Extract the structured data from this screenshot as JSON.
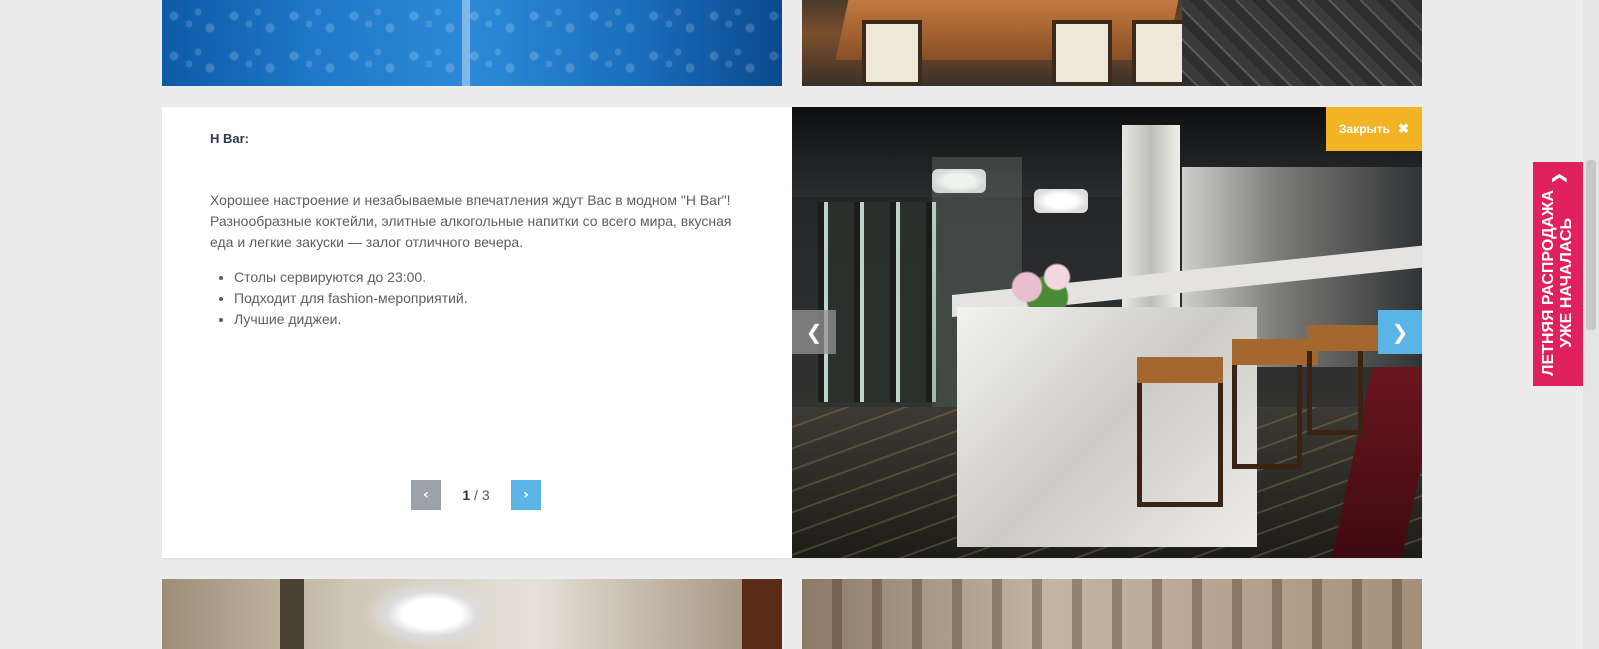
{
  "card": {
    "title": "H Bar:",
    "description": "Хорошее настроение и незабываемые впечатления ждут Вас в модном \"H Bar\"! Разнообразные коктейли, элитные алкогольные напитки со всего мира, вкусная еда и легкие закуски — залог отличного вечера.",
    "bullets": [
      "Столы сервируются до 23:00.",
      "Подходит для fashion-мероприятий.",
      "Лучшие диджеи."
    ],
    "pager": {
      "current": "1",
      "separator": "/ 3",
      "prev_icon": "chevron-left-icon",
      "next_icon": "chevron-right-icon"
    }
  },
  "slider": {
    "close_label": "Закрыть",
    "close_icon": "✖",
    "prev_icon": "chevron-left-icon",
    "next_icon": "chevron-right-icon",
    "image_alt": "H Bar interior with marble counter and bar stools"
  },
  "promo": {
    "line1": "ЛЕТНЯЯ РАСПРОДАЖА",
    "line2": "УЖЕ НАЧАЛАСЬ",
    "icon": "chevron-up-icon"
  },
  "colors": {
    "accent_blue": "#5ab4e5",
    "close_yellow": "#f2b325",
    "promo_pink": "#e0215e",
    "title_navy": "#2a3b52"
  }
}
